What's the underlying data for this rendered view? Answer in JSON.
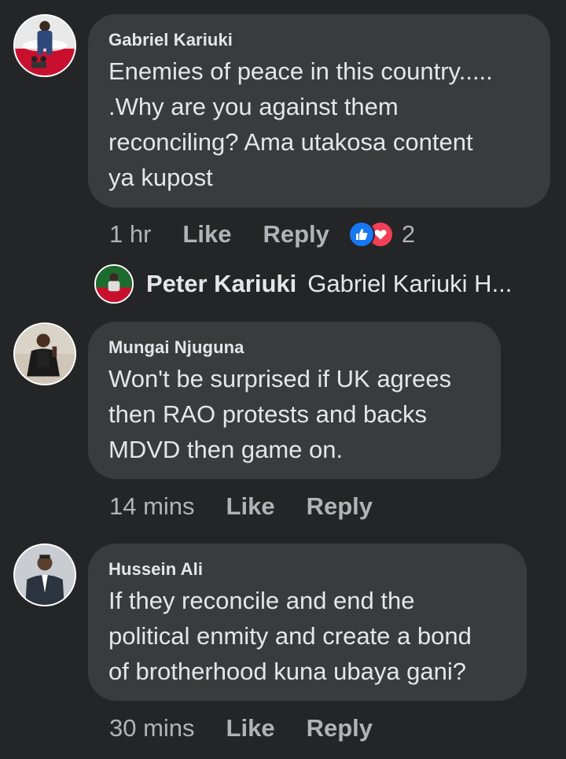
{
  "comments": [
    {
      "author": "Gabriel Kariuki",
      "text": "Enemies of peace in this country.....\n.Why are you against them\nreconciling? Ama utakosa content\nya kupost",
      "time": "1 hr",
      "like_label": "Like",
      "reply_label": "Reply",
      "reaction_count": "2",
      "avatar_icon": "person-red-banner-avatar"
    },
    {
      "author": "Mungai Njuguna",
      "text": "Won't be surprised if UK agrees\nthen RAO protests and backs\nMDVD then game on.",
      "time": "14 mins",
      "like_label": "Like",
      "reply_label": "Reply",
      "avatar_icon": "man-sitting-avatar"
    },
    {
      "author": "Hussein Ali",
      "text": "If they reconcile and end the\npolitical enmity and create a bond\nof brotherhood kuna ubaya gani?",
      "time": "30 mins",
      "like_label": "Like",
      "reply_label": "Reply",
      "avatar_icon": "man-suit-avatar"
    }
  ],
  "reply_preview": {
    "author": "Peter Kariuki",
    "text": "Gabriel Kariuki H..."
  },
  "colors": {
    "background": "#242526",
    "bubble": "#3a3b3c",
    "text": "#e4e6eb",
    "secondary_text": "#b0b3b8",
    "like_blue": "#1877f2",
    "love_red": "#f33e58"
  }
}
